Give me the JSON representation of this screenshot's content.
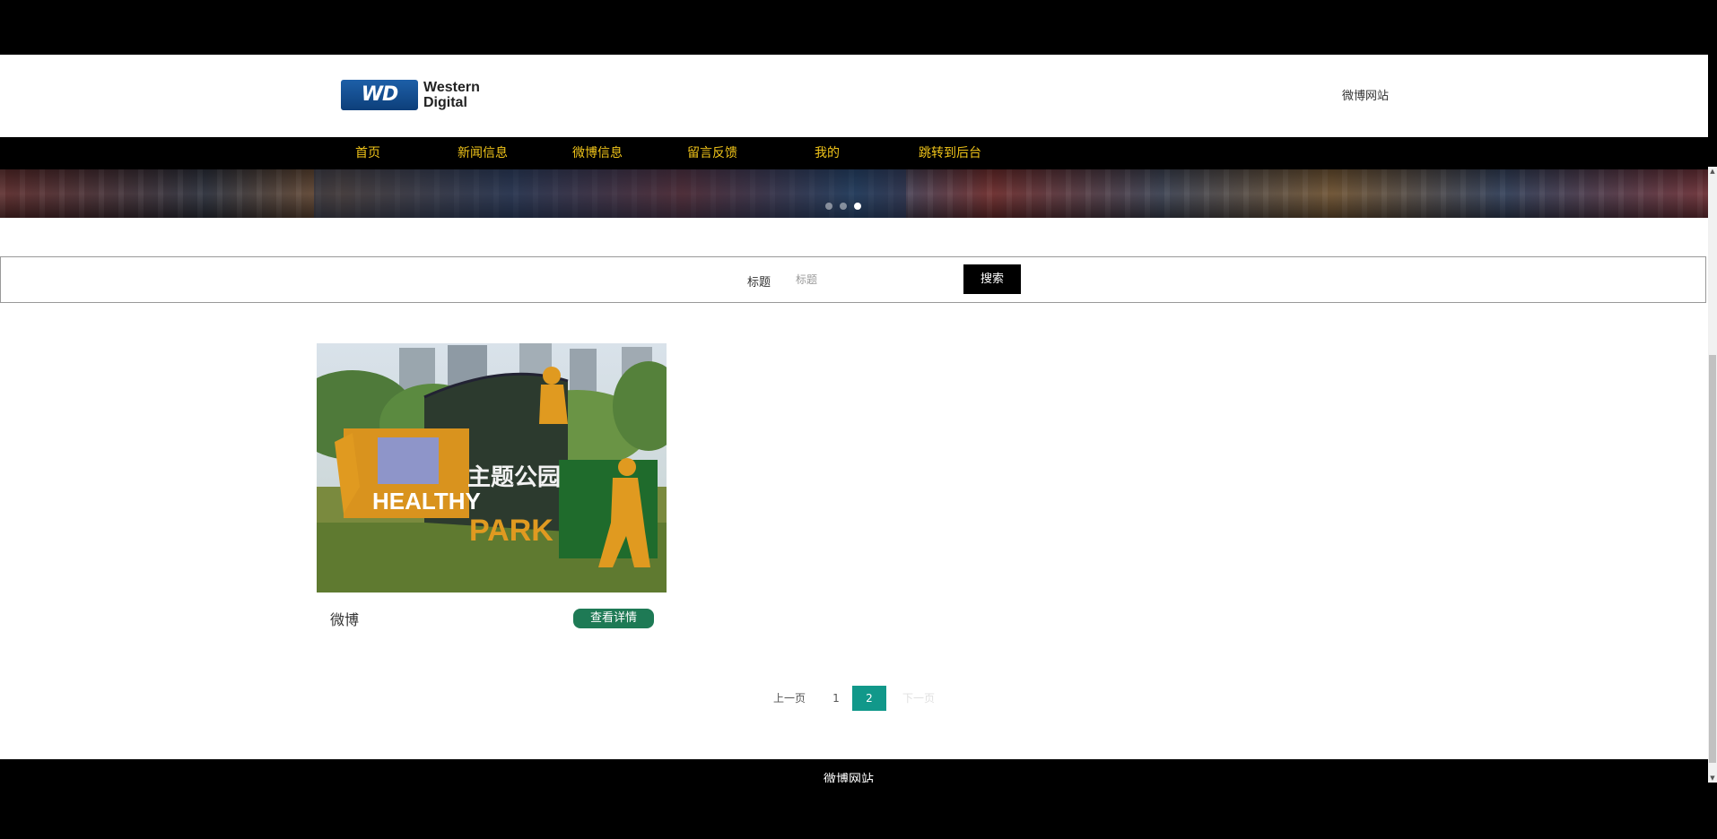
{
  "header": {
    "logo": {
      "badge": "WD",
      "line1": "Western",
      "line2": "Digital"
    },
    "site_title": "微博网站"
  },
  "nav": {
    "items": [
      {
        "label": "首页"
      },
      {
        "label": "新闻信息"
      },
      {
        "label": "微博信息"
      },
      {
        "label": "留言反馈"
      },
      {
        "label": "我的"
      },
      {
        "label": "跳转到后台"
      }
    ]
  },
  "banner": {
    "slides": 3,
    "active_slide": 3
  },
  "search": {
    "label": "标题",
    "placeholder": "标题",
    "value": "",
    "button_label": "搜索"
  },
  "cards": [
    {
      "title": "微博",
      "button_label": "查看详情",
      "image": {
        "sign_cn": "主题公园",
        "sign_en1": "HEALTHY",
        "sign_en2": "PARK"
      }
    }
  ],
  "pagination": {
    "prev_label": "上一页",
    "pages": [
      "1",
      "2"
    ],
    "current": "2",
    "next_label": "下一页"
  },
  "footer": {
    "text": "微博网站"
  },
  "colors": {
    "nav_bg": "#000000",
    "nav_text": "#f0c419",
    "button_green": "#1e7a55",
    "pager_active": "#11988a",
    "logo_blue": "#1d5fa8"
  }
}
